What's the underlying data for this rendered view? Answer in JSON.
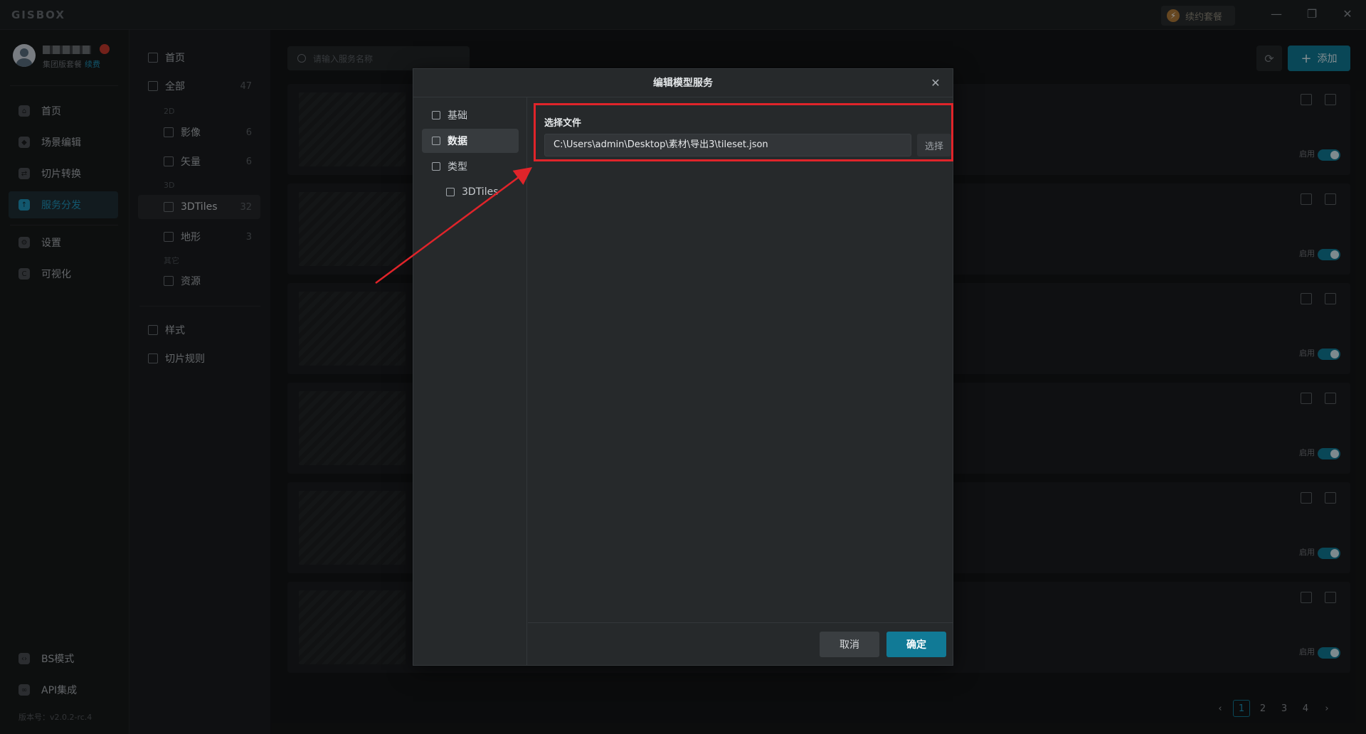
{
  "app": {
    "logo": "GISBOX",
    "renew_label": "续约套餐"
  },
  "window": {
    "minimize": "—",
    "restore": "❐",
    "close": "✕"
  },
  "user": {
    "plan": "集团版套餐",
    "renew_link": "续费"
  },
  "sidebar": {
    "items": [
      {
        "label": "首页"
      },
      {
        "label": "场景编辑"
      },
      {
        "label": "切片转换"
      },
      {
        "label": "服务分发"
      },
      {
        "label": "设置"
      },
      {
        "label": "可视化"
      }
    ],
    "bottom": [
      {
        "label": "BS模式"
      },
      {
        "label": "API集成"
      }
    ],
    "version": "版本号：v2.0.2-rc.4"
  },
  "subbar": {
    "home": "首页",
    "all": {
      "label": "全部",
      "count": "47"
    },
    "group_2d": "2D",
    "imagery": {
      "label": "影像",
      "count": "6"
    },
    "vector": {
      "label": "矢量",
      "count": "6"
    },
    "group_3d": "3D",
    "tiles3d": {
      "label": "3DTiles",
      "count": "32"
    },
    "terrain": {
      "label": "地形",
      "count": "3"
    },
    "group_other": "其它",
    "assets": {
      "label": "资源"
    },
    "style": "样式",
    "rules": "切片规则"
  },
  "content": {
    "search_placeholder": "请输入服务名称",
    "add_label": "添加",
    "enabled_label": "启用",
    "pages": [
      "1",
      "2",
      "3",
      "4"
    ]
  },
  "modal": {
    "title": "编辑模型服务",
    "nav": [
      {
        "label": "基础"
      },
      {
        "label": "数据"
      },
      {
        "label": "类型"
      },
      {
        "label": "3DTiles"
      }
    ],
    "field_label": "选择文件",
    "file_path": "C:\\Users\\admin\\Desktop\\素材\\导出3\\tileset.json",
    "pick_label": "选择",
    "cancel_label": "取消",
    "ok_label": "确定"
  },
  "colors": {
    "accent": "#117a96",
    "highlight": "#e0242a"
  }
}
